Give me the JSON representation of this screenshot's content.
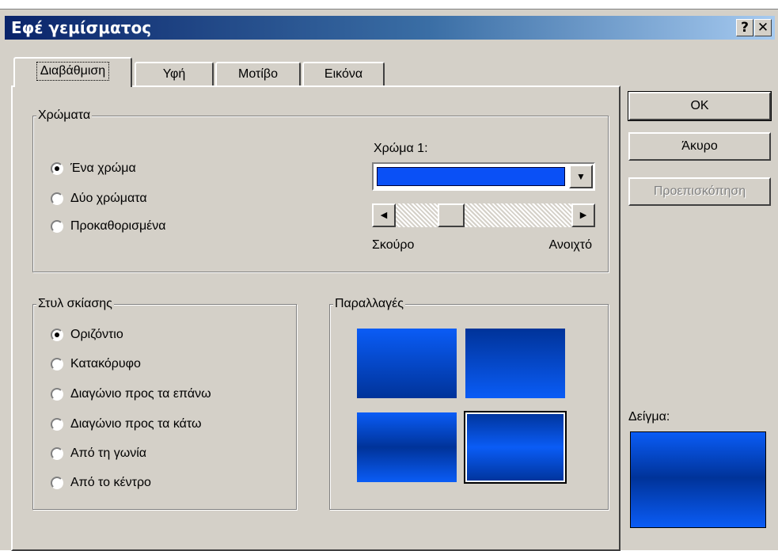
{
  "window": {
    "title": "Εφέ γεμίσματος",
    "help_glyph": "?",
    "close_glyph": "✕"
  },
  "tabs": [
    {
      "label": "Διαβάθμιση",
      "active": true
    },
    {
      "label": "Υφή"
    },
    {
      "label": "Μοτίβο"
    },
    {
      "label": "Εικόνα"
    }
  ],
  "colors_group": {
    "legend": "Χρώματα",
    "options": [
      {
        "label": "Ένα χρώμα",
        "selected": true
      },
      {
        "label": "Δύο χρώματα",
        "selected": false
      },
      {
        "label": "Προκαθορισμένα",
        "selected": false
      }
    ],
    "color1_label": "Χρώμα 1:",
    "color1_value": "#0a50f6",
    "dark_label": "Σκούρο",
    "light_label": "Ανοιχτό",
    "slider_position": 0.28
  },
  "shading_group": {
    "legend": "Στυλ σκίασης",
    "options": [
      {
        "label": "Οριζόντιο",
        "selected": true
      },
      {
        "label": "Κατακόρυφο",
        "selected": false
      },
      {
        "label": "Διαγώνιο προς τα επάνω",
        "selected": false
      },
      {
        "label": "Διαγώνιο προς τα κάτω",
        "selected": false
      },
      {
        "label": "Από τη γωνία",
        "selected": false
      },
      {
        "label": "Από το κέντρο",
        "selected": false
      }
    ]
  },
  "variants_group": {
    "legend": "Παραλλαγές",
    "selected_index": 3
  },
  "buttons": {
    "ok": "ΟΚ",
    "cancel": "Άκυρο",
    "preview": "Προεπισκόπηση"
  },
  "sample": {
    "label": "Δείγμα:"
  },
  "colors": {
    "title_start": "#0a246a",
    "title_end": "#a6caf0",
    "dialog_bg": "#d4d0c8",
    "fill_light": "#0a5cf6",
    "fill_dark": "#003399"
  }
}
